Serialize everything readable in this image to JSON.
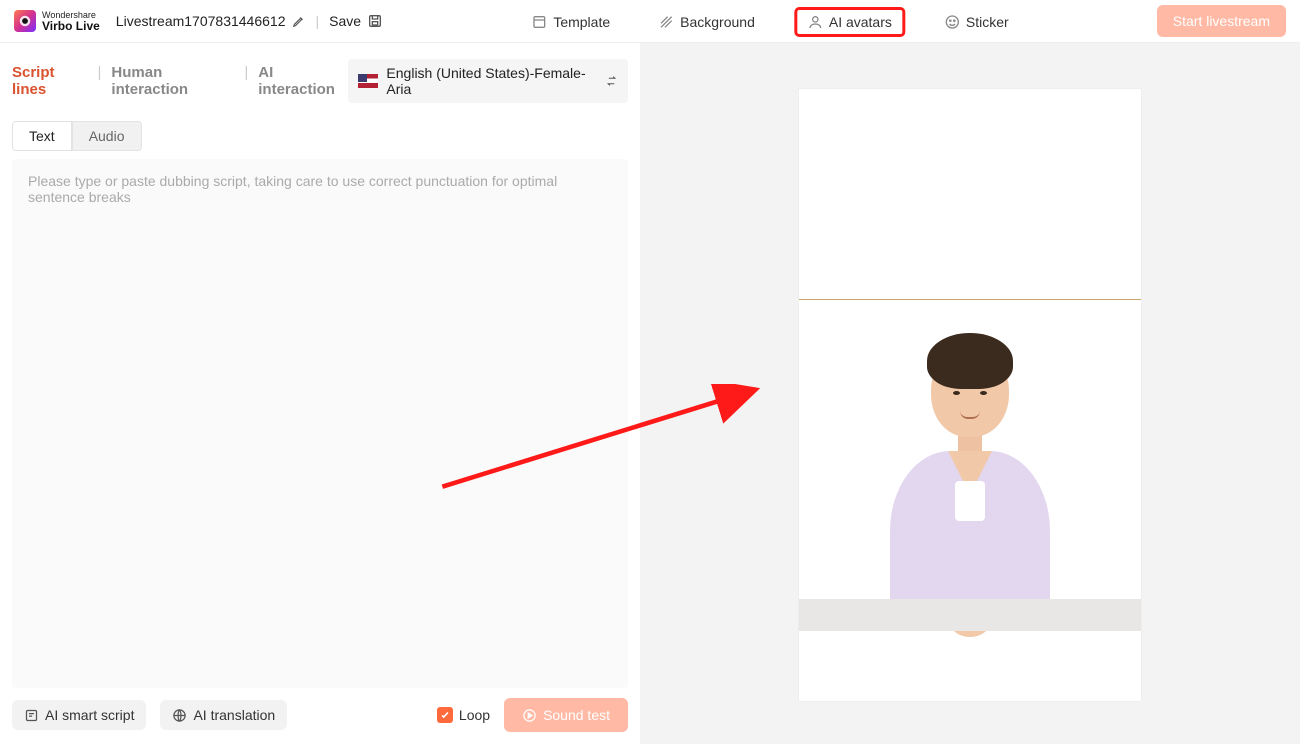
{
  "brand": {
    "small": "Wondershare",
    "big": "Virbo Live"
  },
  "project": {
    "name": "Livestream1707831446612"
  },
  "toolbar": {
    "save_label": "Save"
  },
  "top_tabs": {
    "template": "Template",
    "background": "Background",
    "ai_avatars": "AI avatars",
    "sticker": "Sticker"
  },
  "cta": {
    "start": "Start livestream"
  },
  "main_tabs": {
    "script": "Script lines",
    "human": "Human interaction",
    "ai": "AI interaction"
  },
  "voice": {
    "label": "English (United States)-Female-Aria"
  },
  "sub_tabs": {
    "text": "Text",
    "audio": "Audio"
  },
  "editor": {
    "placeholder": "Please type or paste dubbing script, taking care to use correct punctuation for optimal sentence breaks"
  },
  "bottom": {
    "smart": "AI smart script",
    "translate": "AI translation",
    "loop": "Loop",
    "sound_test": "Sound test"
  }
}
